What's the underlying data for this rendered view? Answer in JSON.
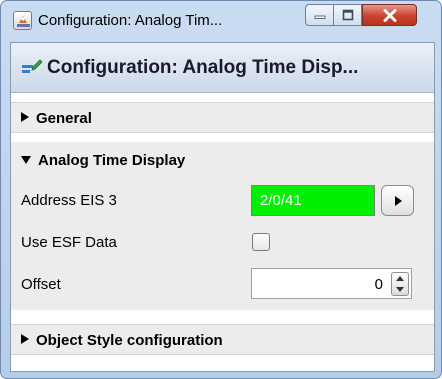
{
  "window": {
    "title": "Configuration: Analog Tim...",
    "icon": "app-window-icon",
    "buttons": [
      "minimize-icon",
      "maximize-icon",
      "close-icon"
    ]
  },
  "panel": {
    "header_title": "Configuration: Analog Time Disp...",
    "header_icon": "edit-config-icon"
  },
  "sections": {
    "general": {
      "label": "General",
      "expanded": false
    },
    "analog_time_display": {
      "label": "Analog Time Display",
      "expanded": true,
      "fields": {
        "address": {
          "label": "Address EIS 3",
          "value": "2/0/41",
          "color": "#00ee00"
        },
        "use_esf": {
          "label": "Use ESF Data",
          "checked": false
        },
        "offset": {
          "label": "Offset",
          "value": "0"
        }
      }
    },
    "object_style": {
      "label": "Object Style configuration",
      "expanded": false
    }
  },
  "colors": {
    "address_background": "#00ee00",
    "close_button": "#c8432d",
    "title_bar": "#c9dcf1"
  }
}
